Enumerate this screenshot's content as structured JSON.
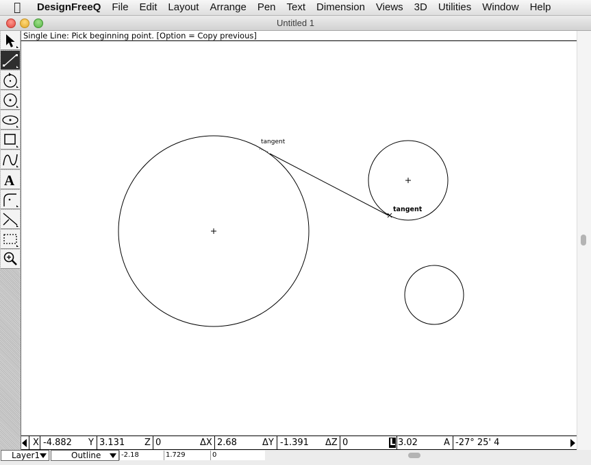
{
  "menubar": {
    "app_name": "DesignFreeQ",
    "items": [
      "File",
      "Edit",
      "Layout",
      "Arrange",
      "Pen",
      "Text",
      "Dimension",
      "Views",
      "3D",
      "Utilities",
      "Window",
      "Help"
    ]
  },
  "window": {
    "title": "Untitled 1"
  },
  "prompt": {
    "text": "Single Line: Pick beginning point.  [Option = Copy previous]"
  },
  "canvas": {
    "snap_label_1": "tangent",
    "snap_label_2": "tangent"
  },
  "tools": [
    {
      "name": "select-arrow-tool",
      "icon": "arrow-pointer-icon",
      "selected": false
    },
    {
      "name": "line-tool",
      "icon": "line-icon",
      "selected": true
    },
    {
      "name": "arc-tool",
      "icon": "arc-rotate-icon",
      "selected": false
    },
    {
      "name": "circle-tool",
      "icon": "circle-icon",
      "selected": false
    },
    {
      "name": "ellipse-tool",
      "icon": "ellipse-icon",
      "selected": false
    },
    {
      "name": "rectangle-tool",
      "icon": "rectangle-icon",
      "selected": false
    },
    {
      "name": "curve-tool",
      "icon": "bezier-curve-icon",
      "selected": false
    },
    {
      "name": "text-tool",
      "icon": "text-icon",
      "selected": false
    },
    {
      "name": "fillet-tool",
      "icon": "fillet-icon",
      "selected": false
    },
    {
      "name": "trim-tool",
      "icon": "trim-icon",
      "selected": false
    },
    {
      "name": "marquee-tool",
      "icon": "dashed-rectangle-icon",
      "selected": false
    },
    {
      "name": "zoom-tool",
      "icon": "magnifier-icon",
      "selected": false
    }
  ],
  "coords": {
    "x_label": "X",
    "x_value": "-4.882",
    "y_label": "Y",
    "y_value": "3.131",
    "z_label": "Z",
    "z_value": "0",
    "dx_label": "ΔX",
    "dx_value": "2.68",
    "dy_label": "ΔY",
    "dy_value": "-1.391",
    "dz_label": "ΔZ",
    "dz_value": "0",
    "l_label": "L",
    "l_value": "3.02",
    "a_label": "A",
    "a_value": "-27° 25' 4"
  },
  "status": {
    "layer": "Layer1",
    "view_mode": "Outline",
    "field_1": "-2.18",
    "field_2": "1.729",
    "field_3": "0"
  }
}
